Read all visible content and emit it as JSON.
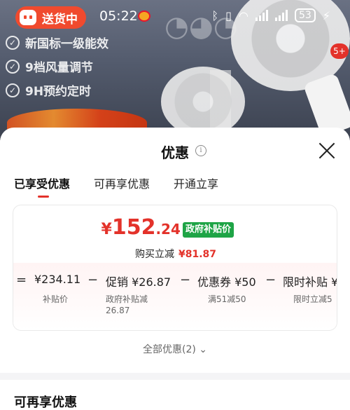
{
  "status_bar": {
    "delivery_label": "送货中",
    "time": "05:22",
    "battery": "53"
  },
  "banner": {
    "features": [
      "新国标一级能效",
      "9档风量调节",
      "9H预约定时"
    ],
    "cart_badge": "5+"
  },
  "sheet": {
    "title": "优惠",
    "tabs": [
      {
        "label": "已享受优惠",
        "active": true
      },
      {
        "label": "可再享优惠",
        "active": false
      },
      {
        "label": "开通立享",
        "active": false
      }
    ],
    "price": {
      "currency": "¥",
      "integer": "152",
      "decimal": ".24",
      "tag": "政府补贴价",
      "discount_label": "购买立减",
      "discount_value": "¥81.87"
    },
    "formula": [
      {
        "op": "=",
        "value": "¥234.11",
        "desc": "补贴价"
      },
      {
        "op": "−",
        "value": "促销 ¥26.87",
        "desc": "政府补贴减\n26.87"
      },
      {
        "op": "−",
        "value": "优惠券 ¥50",
        "desc": "满51减50"
      },
      {
        "op": "−",
        "value": "限时补贴 ¥",
        "desc": "限时立减5"
      }
    ],
    "all_offers": "全部优惠(2) ⌄",
    "section_title": "可再享优惠"
  },
  "colors": {
    "accent": "#e3322a",
    "gov_tag": "#1ea446",
    "delivery_pill": "#f04a2e"
  }
}
